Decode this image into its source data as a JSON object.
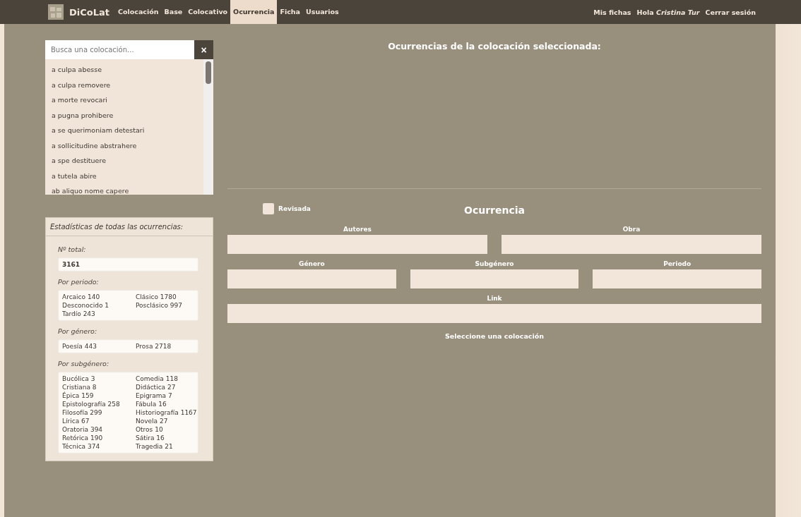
{
  "nav": {
    "brand": "DiCoLat",
    "items": [
      {
        "label": "Colocación",
        "selected": false
      },
      {
        "label": "Base",
        "selected": false
      },
      {
        "label": "Colocativo",
        "selected": false
      },
      {
        "label": "Ocurrencia",
        "selected": true
      },
      {
        "label": "Ficha",
        "selected": false
      },
      {
        "label": "Usuarios",
        "selected": false
      }
    ],
    "right": {
      "my_cards": "Mis fichas",
      "greeting": "Hola",
      "user": "Cristina Tur",
      "logout": "Cerrar sesión"
    }
  },
  "search": {
    "placeholder": "Busca una colocación...",
    "clear": "×"
  },
  "collocations": [
    "a culpa abesse",
    "a culpa removere",
    "a morte revocari",
    "a pugna prohibere",
    "a se querimoniam detestari",
    "a sollicitudine abstrahere",
    "a spe destituere",
    "a tutela abire",
    "ab aliquo nome capere"
  ],
  "stats": {
    "title": "Estadísticas de todas las ocurrencias:",
    "total": {
      "label": "Nº total:",
      "value": "3161"
    },
    "groups": [
      {
        "label": "Por periodo:",
        "items": [
          "Arcaico 140",
          "Clásico 1780",
          "Desconocido 1",
          "Posclásico 997",
          "Tardío 243"
        ]
      },
      {
        "label": "Por género:",
        "items": [
          "Poesía 443",
          "Prosa 2718"
        ]
      },
      {
        "label": "Por subgénero:",
        "items": [
          "Bucólica 3",
          "Comedia 118",
          "Cristiana 8",
          "Didáctica 27",
          "Épica 159",
          "Epigrama 7",
          "Epistolografía 258",
          "Fábula 16",
          "Filosofía 299",
          "Historiografía 1167",
          "Lírica 67",
          "Novela 27",
          "Oratoria 394",
          "Otros 10",
          "Retórica 190",
          "Sátira 16",
          "Técnica 374",
          "Tragedia 21"
        ]
      }
    ]
  },
  "occurrences_title": "Ocurrencias de la colocación seleccionada:",
  "form": {
    "reviewed": {
      "label": "Revisada",
      "checked": false
    },
    "title": "Ocurrencia",
    "rows": [
      [
        "Autores",
        "Obra"
      ],
      [
        "Género",
        "Subgénero",
        "Periodo"
      ],
      [
        "Link"
      ]
    ],
    "message": "Seleccione una colocación"
  }
}
